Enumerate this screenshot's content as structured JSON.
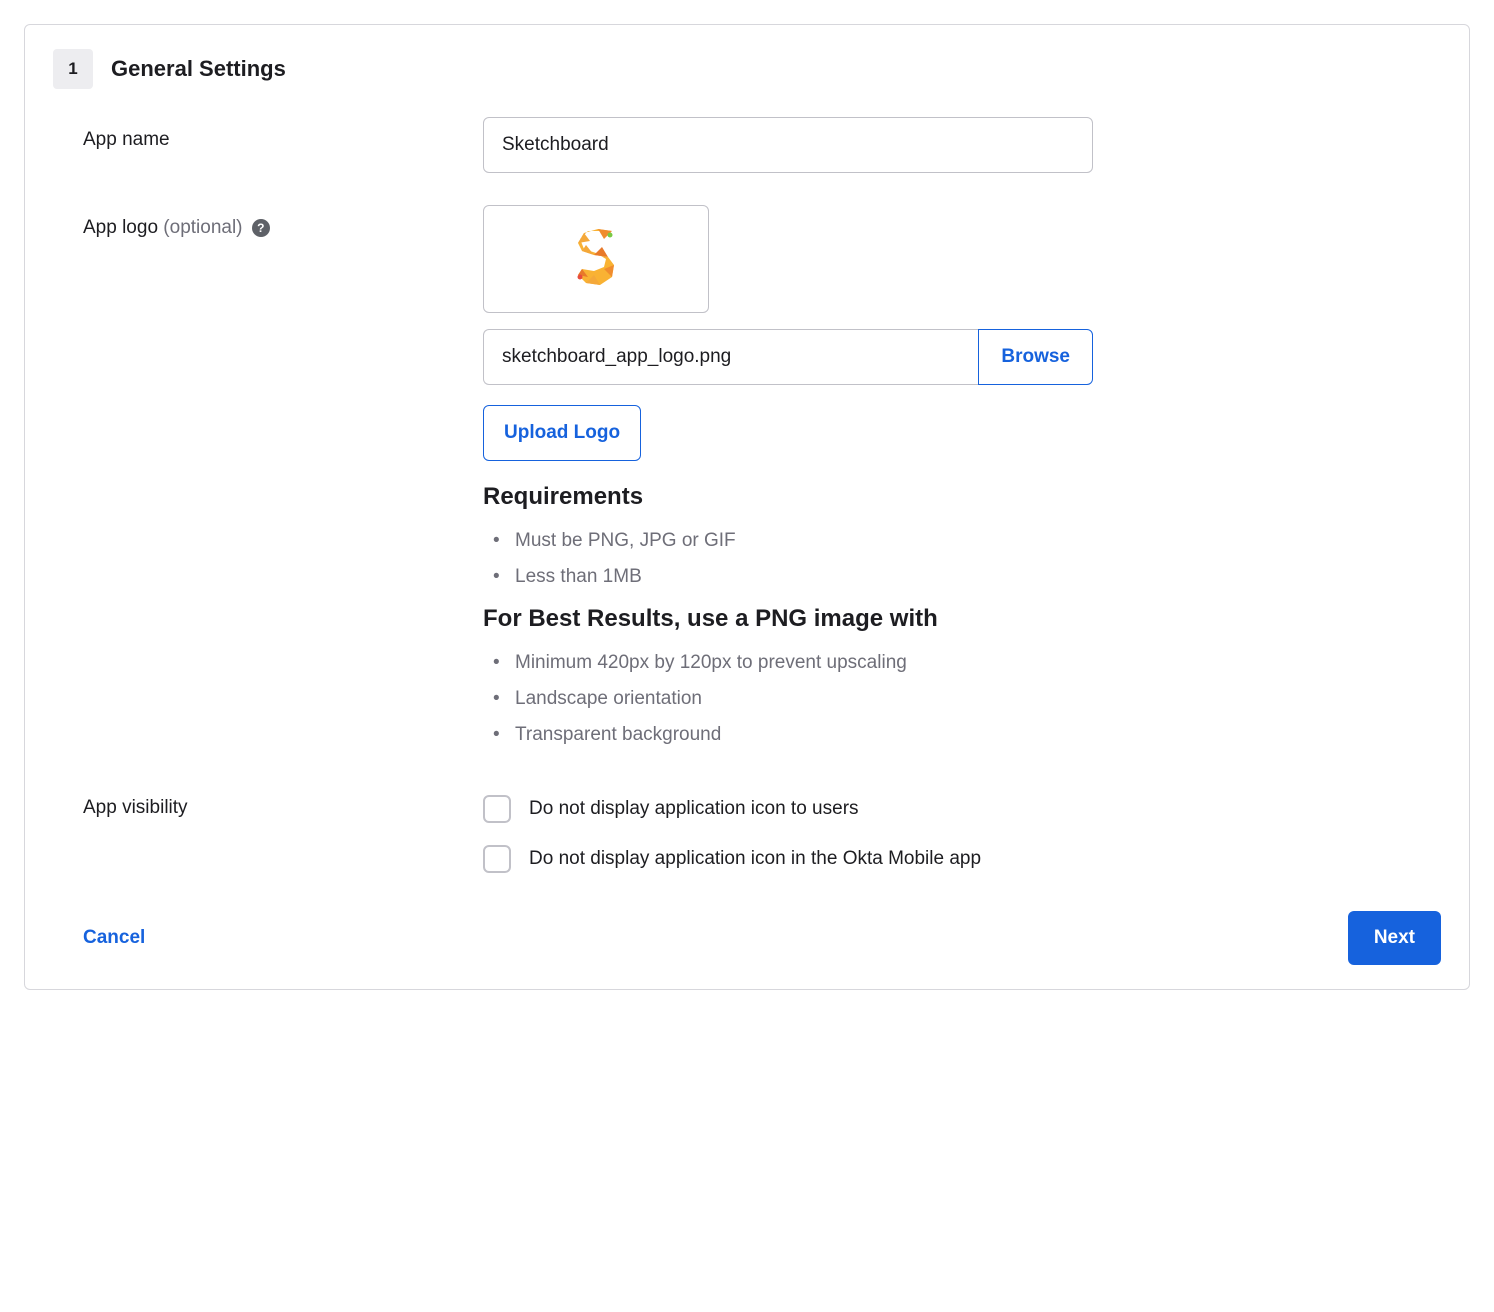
{
  "step": {
    "number": "1",
    "title": "General Settings"
  },
  "appName": {
    "label": "App name",
    "value": "Sketchboard"
  },
  "appLogo": {
    "label": "App logo ",
    "optional": "(optional)",
    "fileName": "sketchboard_app_logo.png",
    "browseLabel": "Browse",
    "uploadLabel": "Upload Logo",
    "requirementsHeading": "Requirements",
    "requirements": [
      "Must be PNG, JPG or GIF",
      "Less than 1MB"
    ],
    "bestResultsHeading": "For Best Results, use a PNG image with",
    "bestResults": [
      "Minimum 420px by 120px to prevent upscaling",
      "Landscape orientation",
      "Transparent background"
    ]
  },
  "appVisibility": {
    "label": "App visibility",
    "option1": "Do not display application icon to users",
    "option2": "Do not display application icon in the Okta Mobile app"
  },
  "footer": {
    "cancel": "Cancel",
    "next": "Next"
  }
}
